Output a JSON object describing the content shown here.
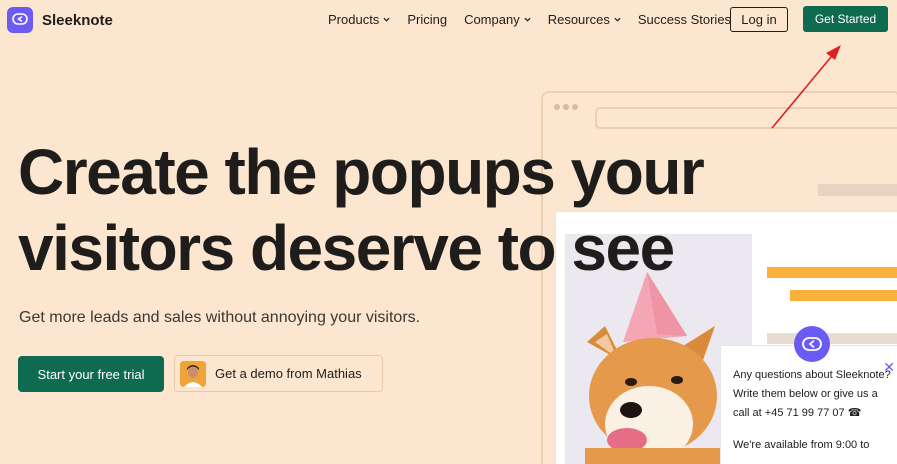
{
  "brand": {
    "name": "Sleeknote",
    "logo_icon": "chat-bubble-icon",
    "accent": "#6a5cf2"
  },
  "nav": {
    "items": [
      {
        "label": "Products",
        "has_dropdown": true
      },
      {
        "label": "Pricing",
        "has_dropdown": false
      },
      {
        "label": "Company",
        "has_dropdown": true
      },
      {
        "label": "Resources",
        "has_dropdown": true
      },
      {
        "label": "Success Stories",
        "has_dropdown": false
      }
    ],
    "login_label": "Log in",
    "cta_label": "Get Started",
    "cta_color": "#0f6b4f"
  },
  "hero": {
    "title_line1": "Create the popups your",
    "title_line2": "visitors deserve to see",
    "subtitle": "Get more leads and sales without annoying your visitors.",
    "trial_label": "Start your free trial",
    "demo_label": "Get a demo from Mathias"
  },
  "chat": {
    "line1": "Any questions about Sleeknote?",
    "line2": "Write them below or give us a",
    "line3": "call at +45 71 99 77 07",
    "phone_icon": "☎",
    "line4": "We're available from 9:00 to",
    "close_symbol": "✕"
  },
  "colors": {
    "background": "#fde6cf",
    "annotation_arrow": "#e02020",
    "illustration_orange": "#fbb03b"
  }
}
